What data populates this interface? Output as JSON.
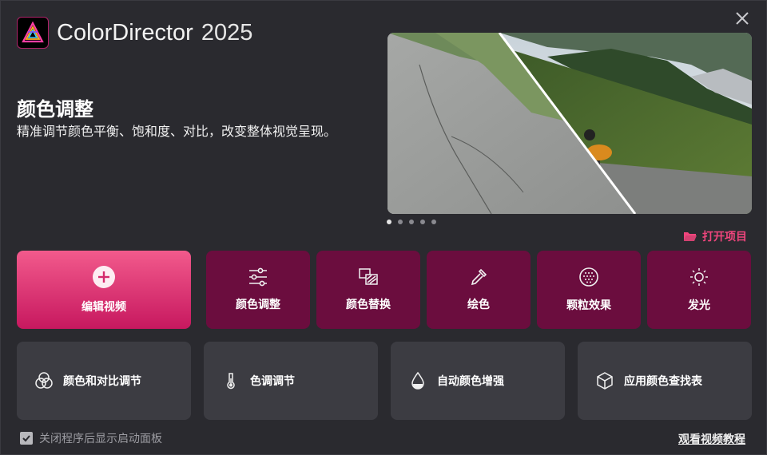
{
  "app": {
    "title": "ColorDirector",
    "year": "2025",
    "logo_icon": "colordirector-logo-icon",
    "close_icon": "close-icon"
  },
  "feature": {
    "title": "颜色调整",
    "description": "精准调节颜色平衡、饱和度、对比，改变整体视觉呈现。"
  },
  "carousel": {
    "dot_count": 5,
    "active_index": 0
  },
  "open_project": {
    "label": "打开项目",
    "icon": "folder-open-icon"
  },
  "primary_action": {
    "label": "编辑视频",
    "icon": "plus-circle-icon"
  },
  "features": [
    {
      "label": "颜色调整",
      "icon": "sliders-icon"
    },
    {
      "label": "颜色替换",
      "icon": "color-replace-icon"
    },
    {
      "label": "绘色",
      "icon": "eyedropper-icon"
    },
    {
      "label": "颗粒效果",
      "icon": "grain-icon"
    },
    {
      "label": "发光",
      "icon": "sun-glow-icon"
    }
  ],
  "tools": [
    {
      "label": "颜色和对比调节",
      "icon": "color-circles-icon"
    },
    {
      "label": "色调调节",
      "icon": "thermometer-icon"
    },
    {
      "label": "自动颜色增强",
      "icon": "droplet-icon"
    },
    {
      "label": "应用颜色查找表",
      "icon": "cube-icon"
    }
  ],
  "footer": {
    "startup_checkbox_label": "关闭程序后显示启动面板",
    "startup_checked": true,
    "tutorial_link": "观看视频教程"
  },
  "colors": {
    "background": "#2a2a2f",
    "accent": "#f0457d",
    "primary_tile_top": "#f25a8c",
    "primary_tile_bottom": "#c7185f",
    "feature_tile": "#6b0d3e",
    "tool_tile": "#3c3c42"
  }
}
